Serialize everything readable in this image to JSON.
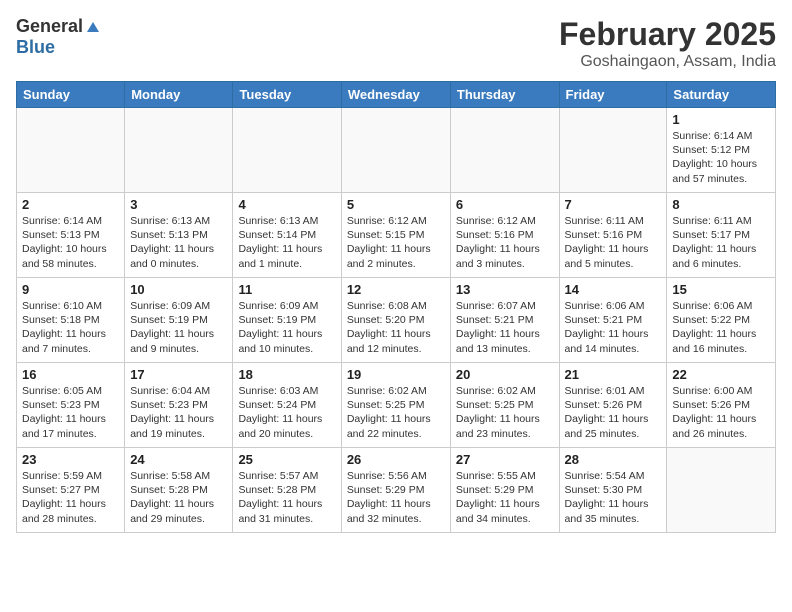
{
  "header": {
    "logo_general": "General",
    "logo_blue": "Blue",
    "month": "February 2025",
    "location": "Goshaingaon, Assam, India"
  },
  "weekdays": [
    "Sunday",
    "Monday",
    "Tuesday",
    "Wednesday",
    "Thursday",
    "Friday",
    "Saturday"
  ],
  "weeks": [
    [
      {
        "day": "",
        "info": ""
      },
      {
        "day": "",
        "info": ""
      },
      {
        "day": "",
        "info": ""
      },
      {
        "day": "",
        "info": ""
      },
      {
        "day": "",
        "info": ""
      },
      {
        "day": "",
        "info": ""
      },
      {
        "day": "1",
        "info": "Sunrise: 6:14 AM\nSunset: 5:12 PM\nDaylight: 10 hours and 57 minutes."
      }
    ],
    [
      {
        "day": "2",
        "info": "Sunrise: 6:14 AM\nSunset: 5:13 PM\nDaylight: 10 hours and 58 minutes."
      },
      {
        "day": "3",
        "info": "Sunrise: 6:13 AM\nSunset: 5:13 PM\nDaylight: 11 hours and 0 minutes."
      },
      {
        "day": "4",
        "info": "Sunrise: 6:13 AM\nSunset: 5:14 PM\nDaylight: 11 hours and 1 minute."
      },
      {
        "day": "5",
        "info": "Sunrise: 6:12 AM\nSunset: 5:15 PM\nDaylight: 11 hours and 2 minutes."
      },
      {
        "day": "6",
        "info": "Sunrise: 6:12 AM\nSunset: 5:16 PM\nDaylight: 11 hours and 3 minutes."
      },
      {
        "day": "7",
        "info": "Sunrise: 6:11 AM\nSunset: 5:16 PM\nDaylight: 11 hours and 5 minutes."
      },
      {
        "day": "8",
        "info": "Sunrise: 6:11 AM\nSunset: 5:17 PM\nDaylight: 11 hours and 6 minutes."
      }
    ],
    [
      {
        "day": "9",
        "info": "Sunrise: 6:10 AM\nSunset: 5:18 PM\nDaylight: 11 hours and 7 minutes."
      },
      {
        "day": "10",
        "info": "Sunrise: 6:09 AM\nSunset: 5:19 PM\nDaylight: 11 hours and 9 minutes."
      },
      {
        "day": "11",
        "info": "Sunrise: 6:09 AM\nSunset: 5:19 PM\nDaylight: 11 hours and 10 minutes."
      },
      {
        "day": "12",
        "info": "Sunrise: 6:08 AM\nSunset: 5:20 PM\nDaylight: 11 hours and 12 minutes."
      },
      {
        "day": "13",
        "info": "Sunrise: 6:07 AM\nSunset: 5:21 PM\nDaylight: 11 hours and 13 minutes."
      },
      {
        "day": "14",
        "info": "Sunrise: 6:06 AM\nSunset: 5:21 PM\nDaylight: 11 hours and 14 minutes."
      },
      {
        "day": "15",
        "info": "Sunrise: 6:06 AM\nSunset: 5:22 PM\nDaylight: 11 hours and 16 minutes."
      }
    ],
    [
      {
        "day": "16",
        "info": "Sunrise: 6:05 AM\nSunset: 5:23 PM\nDaylight: 11 hours and 17 minutes."
      },
      {
        "day": "17",
        "info": "Sunrise: 6:04 AM\nSunset: 5:23 PM\nDaylight: 11 hours and 19 minutes."
      },
      {
        "day": "18",
        "info": "Sunrise: 6:03 AM\nSunset: 5:24 PM\nDaylight: 11 hours and 20 minutes."
      },
      {
        "day": "19",
        "info": "Sunrise: 6:02 AM\nSunset: 5:25 PM\nDaylight: 11 hours and 22 minutes."
      },
      {
        "day": "20",
        "info": "Sunrise: 6:02 AM\nSunset: 5:25 PM\nDaylight: 11 hours and 23 minutes."
      },
      {
        "day": "21",
        "info": "Sunrise: 6:01 AM\nSunset: 5:26 PM\nDaylight: 11 hours and 25 minutes."
      },
      {
        "day": "22",
        "info": "Sunrise: 6:00 AM\nSunset: 5:26 PM\nDaylight: 11 hours and 26 minutes."
      }
    ],
    [
      {
        "day": "23",
        "info": "Sunrise: 5:59 AM\nSunset: 5:27 PM\nDaylight: 11 hours and 28 minutes."
      },
      {
        "day": "24",
        "info": "Sunrise: 5:58 AM\nSunset: 5:28 PM\nDaylight: 11 hours and 29 minutes."
      },
      {
        "day": "25",
        "info": "Sunrise: 5:57 AM\nSunset: 5:28 PM\nDaylight: 11 hours and 31 minutes."
      },
      {
        "day": "26",
        "info": "Sunrise: 5:56 AM\nSunset: 5:29 PM\nDaylight: 11 hours and 32 minutes."
      },
      {
        "day": "27",
        "info": "Sunrise: 5:55 AM\nSunset: 5:29 PM\nDaylight: 11 hours and 34 minutes."
      },
      {
        "day": "28",
        "info": "Sunrise: 5:54 AM\nSunset: 5:30 PM\nDaylight: 11 hours and 35 minutes."
      },
      {
        "day": "",
        "info": ""
      }
    ]
  ]
}
